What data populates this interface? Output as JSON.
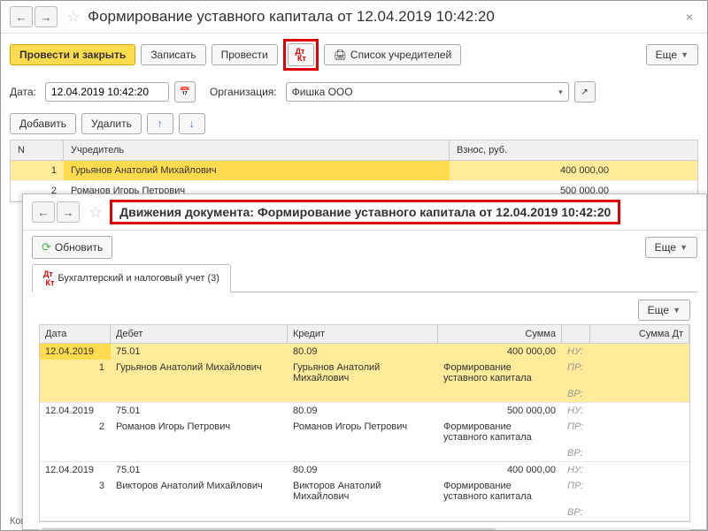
{
  "header": {
    "title": "Формирование уставного капитала от 12.04.2019 10:42:20"
  },
  "toolbar": {
    "post_close": "Провести и закрыть",
    "write": "Записать",
    "post": "Провести",
    "founders": "Список учредителей",
    "more": "Еще"
  },
  "form": {
    "date_label": "Дата:",
    "date_value": "12.04.2019 10:42:20",
    "org_label": "Организация:",
    "org_value": "Фишка ООО"
  },
  "toolbar2": {
    "add": "Добавить",
    "del": "Удалить"
  },
  "grid": {
    "h_n": "N",
    "h_founder": "Учредитель",
    "h_amount": "Взнос, руб.",
    "rows": [
      {
        "n": "1",
        "founder": "Гурьянов Анатолий Михайлович",
        "amount": "400 000,00"
      },
      {
        "n": "2",
        "founder": "Романов Игорь Петрович",
        "amount": "500 000,00"
      }
    ]
  },
  "win2": {
    "title": "Движения документа: Формирование уставного капитала от 12.04.2019 10:42:20",
    "refresh": "Обновить",
    "more": "Еще",
    "tab": "Бухгалтерский и налоговый учет (3)",
    "head": {
      "date": "Дата",
      "debit": "Дебет",
      "credit": "Кредит",
      "sum": "Сумма",
      "sumdt": "Сумма Дт"
    },
    "stubs": {
      "nu": "НУ:",
      "pr": "ПР:",
      "vr": "ВР:"
    },
    "rows": [
      {
        "date": "12.04.2019",
        "n": "1",
        "deb_acc": "75.01",
        "deb_name": "Гурьянов Анатолий Михайлович",
        "cred_acc": "80.09",
        "cred_name": "Гурьянов Анатолий Михайлович",
        "sum": "400 000,00",
        "desc": "Формирование уставного капитала"
      },
      {
        "date": "12.04.2019",
        "n": "2",
        "deb_acc": "75.01",
        "deb_name": "Романов Игорь Петрович",
        "cred_acc": "80.09",
        "cred_name": "Романов Игорь Петрович",
        "sum": "500 000,00",
        "desc": "Формирование уставного капитала"
      },
      {
        "date": "12.04.2019",
        "n": "3",
        "deb_acc": "75.01",
        "deb_name": "Викторов Анатолий Михайлович",
        "cred_acc": "80.09",
        "cred_name": "Викторов Анатолий Михайлович",
        "sum": "400 000,00",
        "desc": "Формирование уставного капитала"
      }
    ]
  },
  "footer": {
    "comment_label": "Комм"
  }
}
